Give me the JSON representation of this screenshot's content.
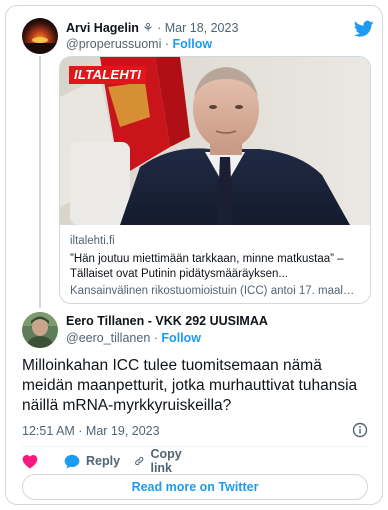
{
  "parent_tweet": {
    "author_name": "Arvi Hagelin",
    "author_emoji": "⚘",
    "date_meta": "· Mar 18, 2023",
    "handle": "@properussuomi",
    "separator": "·",
    "follow_label": "Follow",
    "link_card": {
      "logo_text": "ILTALEHTI",
      "domain": "iltalehti.fi",
      "title": "”Hän joutuu miettimään tarkkaan, minne matkustaa” – Tällaiset ovat Putinin pidätysmääräyksen...",
      "description": "Kansainvälinen rikostuomioistuin (ICC) antoi 17. maal…"
    }
  },
  "reply_tweet": {
    "author_name": "Eero Tillanen - VKK 292 UUSIMAA",
    "handle": "@eero_tillanen",
    "separator": "·",
    "follow_label": "Follow",
    "text": "Milloinkahan ICC tulee tuomitsemaan nämä meidän maanpetturit, jotka murhauttivat tuhansia näillä mRNA-myrkkyruiskeilla?",
    "timestamp": "12:51 AM · Mar 19, 2023"
  },
  "actions": {
    "reply_label": "Reply",
    "copy_label": "Copy link"
  },
  "read_more_label": "Read more on Twitter",
  "icons": {
    "brand": "twitter-bird-icon",
    "like": "heart-icon",
    "reply": "speech-bubble-icon",
    "copy": "link-icon",
    "info": "info-icon"
  },
  "colors": {
    "accent": "#1d9bf0",
    "like": "#f91880",
    "text": "#0f1419",
    "muted": "#536471",
    "border": "#cfd9de",
    "logo_red": "#e3141a"
  }
}
